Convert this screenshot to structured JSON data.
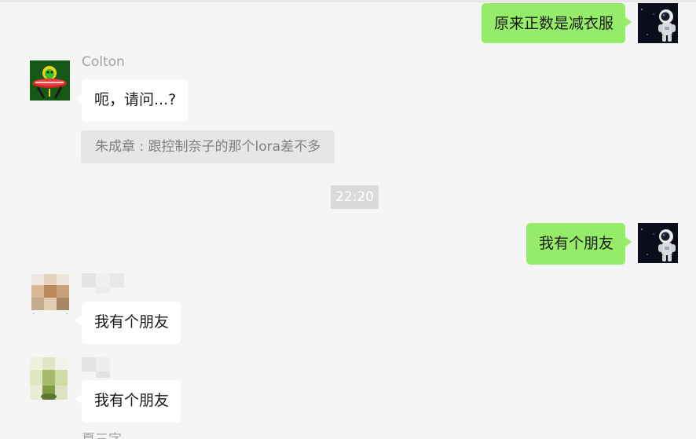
{
  "conversation": {
    "messages": [
      {
        "direction": "outgoing",
        "text": "原来正数是减衣服"
      },
      {
        "direction": "incoming",
        "sender": "Colton",
        "text": "呃，请问...?",
        "quote": "朱成章 : 跟控制奈子的那个lora差不多"
      },
      {
        "direction": "outgoing",
        "text": "我有个朋友"
      },
      {
        "direction": "incoming",
        "sender": "",
        "text": "我有个朋友"
      },
      {
        "direction": "incoming",
        "sender": "",
        "text": "我有个朋友"
      }
    ],
    "timestamp": "22:20",
    "partial_sender": "夏三字"
  },
  "colors": {
    "background": "#f5f5f5",
    "outgoing_bubble": "#95ec69",
    "incoming_bubble": "#ffffff",
    "quote_bg": "#e6e6e6",
    "timestamp_bg": "#dadada"
  },
  "avatars": {
    "self": "astronaut-avatar",
    "colton": "alien-ufo-avatar",
    "member_2": "blurred-food-avatar",
    "member_3": "blurred-plant-avatar"
  }
}
